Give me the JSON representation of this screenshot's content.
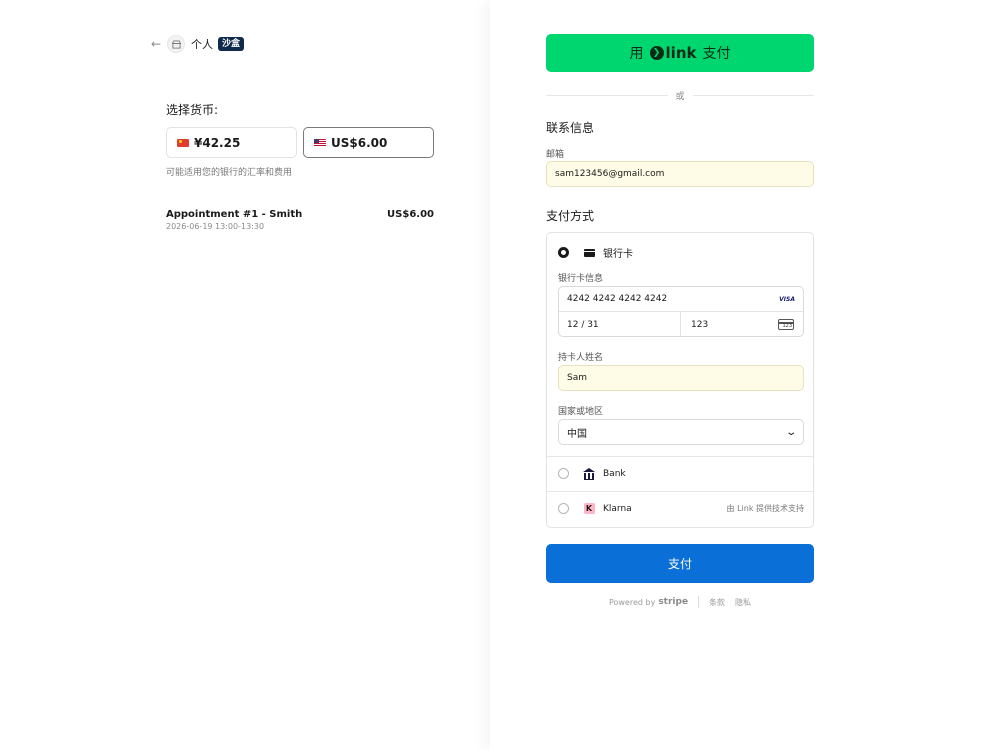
{
  "header": {
    "back_icon": "arrow-left-icon",
    "store_icon": "store-icon",
    "merchant": "个人",
    "badge": "沙盒"
  },
  "currency": {
    "label": "选择货币:",
    "options": [
      {
        "flag": "cn-flag-icon",
        "amount": "¥42.25",
        "selected": false
      },
      {
        "flag": "us-flag-icon",
        "amount": "US$6.00",
        "selected": true
      }
    ],
    "note": "可能适用您的银行的汇率和费用"
  },
  "order": {
    "item_name": "Appointment #1 - Smith",
    "item_price": "US$6.00",
    "item_date": "2026-06-19 13:00-13:30"
  },
  "link_button": {
    "prefix": "用",
    "brand": "link",
    "suffix": "支付",
    "color": "#00d66f"
  },
  "divider_or": "或",
  "contact": {
    "title": "联系信息",
    "email_label": "邮箱",
    "email_value": "sam123456@gmail.com"
  },
  "payment": {
    "title": "支付方式",
    "card_method_label": "银行卡",
    "card_info_label": "银行卡信息",
    "card_number": "4242 4242 4242 4242",
    "card_brand": "VISA",
    "expiry": "12 / 31",
    "cvc": "123",
    "cvc_icon_text": "123",
    "cardholder_label": "持卡人姓名",
    "cardholder_value": "Sam",
    "country_label": "国家或地区",
    "country_value": "中国",
    "bank_label": "Bank",
    "klarna_label": "Klarna",
    "klarna_icon_text": "K",
    "klarna_note": "由 Link 提供技术支持"
  },
  "pay_button": {
    "label": "支付",
    "color": "#0a6fd6"
  },
  "footer": {
    "powered_by": "Powered by",
    "stripe": "stripe",
    "terms": "条款",
    "privacy": "隐私"
  }
}
